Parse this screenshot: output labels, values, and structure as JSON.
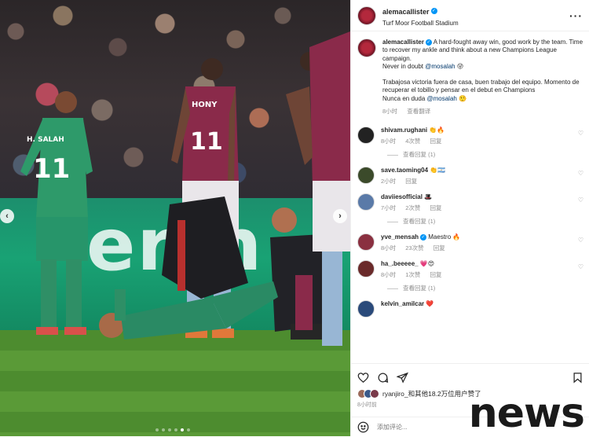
{
  "post": {
    "username": "alemacallister",
    "location": "Turf Moor Football Stadium",
    "caption_en": "A hard-fought away win, good work by the team. Time to recover my ankle and think about a new Champions League campaign.",
    "caption_en_line2_prefix": "Never in doubt ",
    "mention": "@mosalah",
    "caption_es": "Trabajosa victoria fuera de casa, buen trabajo del equipo. Momento de recuperar el tobillo y pensar en el debut en Champions",
    "caption_es_line2_prefix": "Nunca en duda ",
    "caption_emoji_1": "😜",
    "caption_emoji_2": "🤥",
    "time": "8小时",
    "see_translation": "查看翻译"
  },
  "photo": {
    "board_text": "ertn",
    "jersey_left_name": "H. SALAH",
    "jersey_left_number": "11",
    "jersey_center_name": "HONY",
    "jersey_center_number": "11",
    "watermark": "news"
  },
  "comments": [
    {
      "user": "shivam.rughani",
      "text": "👏🔥",
      "time": "8小时",
      "likes": "4次赞",
      "reply": "回复",
      "view_replies": "查看回复 (1)",
      "verified": false
    },
    {
      "user": "save.taoming04",
      "text": "👏🇦🇷",
      "time": "2小时",
      "likes": "",
      "reply": "回复",
      "view_replies": "",
      "verified": false
    },
    {
      "user": "daviiesofficial",
      "text": "🎩",
      "time": "7小时",
      "likes": "2次赞",
      "reply": "回复",
      "view_replies": "查看回复 (1)",
      "verified": false
    },
    {
      "user": "yve_mensah",
      "text": "Maestro 🔥",
      "time": "8小时",
      "likes": "23次赞",
      "reply": "回复",
      "view_replies": "",
      "verified": true
    },
    {
      "user": "ha_.beeeee_",
      "text": "💗😍",
      "time": "8小时",
      "likes": "1次赞",
      "reply": "回复",
      "view_replies": "查看回复 (1)",
      "verified": false
    },
    {
      "user": "kelvin_amilcar",
      "text": "❤️",
      "time": "",
      "likes": "",
      "reply": "",
      "view_replies": "",
      "verified": false
    }
  ],
  "likes_line": "ryanjiro_和其他18.2万位用户赞了",
  "likes_time": "8小时前",
  "comment_placeholder": "添加评论...",
  "icons": {
    "heart": "heart-icon",
    "comment": "comment-icon",
    "share": "share-icon",
    "bookmark": "bookmark-icon",
    "emoji": "emoji-icon",
    "more": "more-icon"
  }
}
